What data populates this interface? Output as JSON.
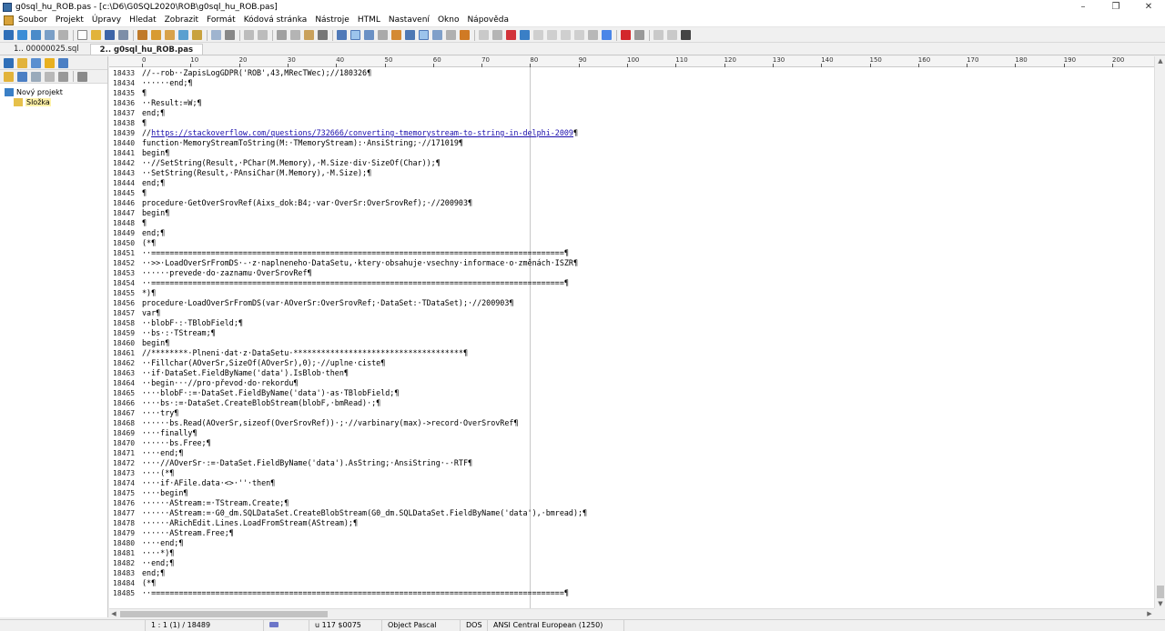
{
  "window": {
    "title": "g0sql_hu_ROB.pas - [c:\\D6\\G0SQL2020\\ROB\\g0sql_hu_ROB.pas]",
    "controls": [
      "–",
      "❐",
      "✕"
    ]
  },
  "menu": [
    "Soubor",
    "Projekt",
    "Úpravy",
    "Hledat",
    "Zobrazit",
    "Formát",
    "Kódová stránka",
    "Nástroje",
    "HTML",
    "Nastavení",
    "Okno",
    "Nápověda"
  ],
  "tabs": [
    {
      "label": "1.. 00000025.sql",
      "active": false
    },
    {
      "label": "2.. g0sql_hu_ROB.pas",
      "active": true
    }
  ],
  "project": {
    "root": "Nový projekt",
    "folder": "Složka"
  },
  "ruler": [
    "0",
    "10",
    "20",
    "30",
    "40",
    "50",
    "60",
    "70",
    "80",
    "90",
    "100",
    "110",
    "120",
    "130",
    "140",
    "150",
    "160",
    "170",
    "180",
    "190",
    "200"
  ],
  "code_lines": [
    {
      "num": "18433",
      "text": "//--rob··ZapisLogGDPR('ROB',43,MRecTWec);//180326¶"
    },
    {
      "num": "18434",
      "text": "······end;¶"
    },
    {
      "num": "18435",
      "text": "¶"
    },
    {
      "num": "18436",
      "text": "··Result:=W;¶"
    },
    {
      "num": "18437",
      "text": "end;¶"
    },
    {
      "num": "18438",
      "text": "¶"
    },
    {
      "num": "18439",
      "text": "//",
      "link": "https://stackoverflow.com/questions/732666/converting-tmemorystream-to-string-in-delphi-2009",
      "tail": "¶"
    },
    {
      "num": "18440",
      "text": "function·MemoryStreamToString(M:·TMemoryStream):·AnsiString;·//171019¶"
    },
    {
      "num": "18441",
      "text": "begin¶"
    },
    {
      "num": "18442",
      "text": "··//SetString(Result,·PChar(M.Memory),·M.Size·div·SizeOf(Char));¶"
    },
    {
      "num": "18443",
      "text": "··SetString(Result,·PAnsiChar(M.Memory),·M.Size);¶"
    },
    {
      "num": "18444",
      "text": "end;¶"
    },
    {
      "num": "18445",
      "text": "¶"
    },
    {
      "num": "18446",
      "text": "procedure·GetOverSrovRef(Aixs_dok:B4;·var·OverSr:OverSrovRef);·//200903¶"
    },
    {
      "num": "18447",
      "text": "begin¶"
    },
    {
      "num": "18448",
      "text": "¶"
    },
    {
      "num": "18449",
      "text": "end;¶"
    },
    {
      "num": "18450",
      "text": "(*¶"
    },
    {
      "num": "18451",
      "text": "··==========================================================================================¶"
    },
    {
      "num": "18452",
      "text": "··>>·LoadOverSrFromDS·-·z·naplneneho·DataSetu,·ktery·obsahuje·vsechny·informace·o·změnách·ISZR¶"
    },
    {
      "num": "18453",
      "text": "······prevede·do·zaznamu·OverSrovRef¶"
    },
    {
      "num": "18454",
      "text": "··==========================================================================================¶"
    },
    {
      "num": "18455",
      "text": "*)¶"
    },
    {
      "num": "18456",
      "text": "procedure·LoadOverSrFromDS(var·AOverSr:OverSrovRef;·DataSet:·TDataSet);·//200903¶"
    },
    {
      "num": "18457",
      "text": "var¶"
    },
    {
      "num": "18458",
      "text": "··blobF·:·TBlobField;¶"
    },
    {
      "num": "18459",
      "text": "··bs·:·TStream;¶"
    },
    {
      "num": "18460",
      "text": "begin¶"
    },
    {
      "num": "18461",
      "text": "//********·Plneni·dat·z·DataSetu·*************************************¶"
    },
    {
      "num": "18462",
      "text": "··Fillchar(AOverSr,SizeOf(AOverSr),0);·//uplne·ciste¶"
    },
    {
      "num": "18463",
      "text": "··if·DataSet.FieldByName('data').IsBlob·then¶"
    },
    {
      "num": "18464",
      "text": "··begin···//pro·převod·do·rekordu¶"
    },
    {
      "num": "18465",
      "text": "····blobF·:=·DataSet.FieldByName('data')·as·TBlobField;¶"
    },
    {
      "num": "18466",
      "text": "····bs·:=·DataSet.CreateBlobStream(blobF,·bmRead)·;¶"
    },
    {
      "num": "18467",
      "text": "····try¶"
    },
    {
      "num": "18468",
      "text": "······bs.Read(AOverSr,sizeof(OverSrovRef))·;·//varbinary(max)->record·OverSrovRef¶"
    },
    {
      "num": "18469",
      "text": "····finally¶"
    },
    {
      "num": "18470",
      "text": "······bs.Free;¶"
    },
    {
      "num": "18471",
      "text": "····end;¶"
    },
    {
      "num": "18472",
      "text": "····//AOverSr·:=·DataSet.FieldByName('data').AsString;·AnsiString·-·RTF¶"
    },
    {
      "num": "18473",
      "text": "····(*¶"
    },
    {
      "num": "18474",
      "text": "····if·AFile.data·<>·''·then¶"
    },
    {
      "num": "18475",
      "text": "····begin¶"
    },
    {
      "num": "18476",
      "text": "······AStream:=·TStream.Create;¶"
    },
    {
      "num": "18477",
      "text": "······AStream:=·G0_dm.SQLDataSet.CreateBlobStream(G0_dm.SQLDataSet.FieldByName('data'),·bmread);¶"
    },
    {
      "num": "18478",
      "text": "······ARichEdit.Lines.LoadFromStream(AStream);¶"
    },
    {
      "num": "18479",
      "text": "······AStream.Free;¶"
    },
    {
      "num": "18480",
      "text": "····end;¶"
    },
    {
      "num": "18481",
      "text": "····*)¶"
    },
    {
      "num": "18482",
      "text": "··end;¶"
    },
    {
      "num": "18483",
      "text": "end;¶"
    },
    {
      "num": "18484",
      "text": "(*¶"
    },
    {
      "num": "18485",
      "text": "··==========================================================================================¶"
    }
  ],
  "status": {
    "position": "1 : 1 (1) / 18489",
    "char": "u   117  $0075",
    "syntax": "Object Pascal",
    "lineend": "DOS",
    "encoding": "ANSI Central European (1250)"
  }
}
